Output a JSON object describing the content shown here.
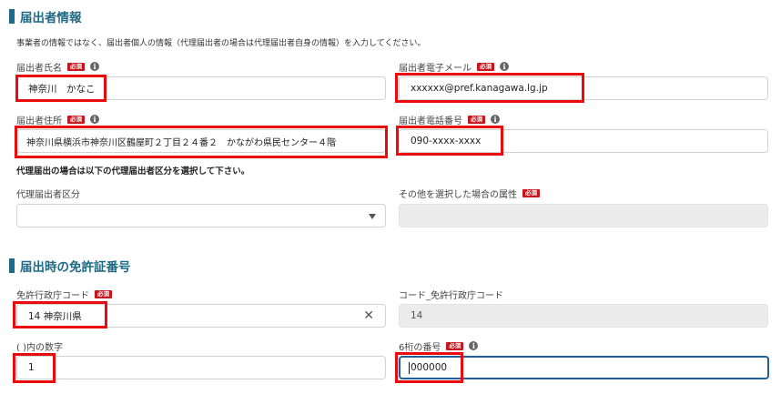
{
  "section1": {
    "title": "届出者情報",
    "description": "事業者の情報ではなく、届出者個人の情報（代理届出者の場合は代理届出者自身の情報）を入力してください。",
    "name": {
      "label": "届出者氏名",
      "required": "必須",
      "value": "神奈川　かなこ"
    },
    "email": {
      "label": "届出者電子メール",
      "required": "必須",
      "value": "xxxxxx@pref.kanagawa.lg.jp"
    },
    "address": {
      "label": "届出者住所",
      "required": "必須",
      "value": "神奈川県横浜市神奈川区鶴屋町２丁目２４番２　かながわ県民センター４階"
    },
    "phone": {
      "label": "届出者電話番号",
      "required": "必須",
      "value": "090-xxxx-xxxx"
    },
    "proxy_note": "代理届出の場合は以下の代理届出者区分を選択して下さい。",
    "proxy_category": {
      "label": "代理届出者区分",
      "value": ""
    },
    "other_attr": {
      "label": "その他を選択した場合の属性",
      "required": "必須",
      "value": ""
    }
  },
  "section2": {
    "title": "届出時の免許証番号",
    "authority": {
      "label": "免許行政庁コード",
      "required": "必須",
      "value": "14 神奈川県"
    },
    "authority_code": {
      "label": "コード_免許行政庁コード",
      "value": "14"
    },
    "paren_number": {
      "label": "( )内の数字",
      "value": "1"
    },
    "six_digit": {
      "label": "6桁の番号",
      "required": "必須",
      "value": "000000"
    }
  },
  "icons": {
    "info": "info-icon",
    "dropdown": "dropdown-arrow-icon",
    "clear": "clear-icon"
  },
  "colors": {
    "accent": "#1e6a87",
    "required_badge": "#c4161c",
    "highlight": "#ea0c0c",
    "focus": "#1f5f9e"
  }
}
